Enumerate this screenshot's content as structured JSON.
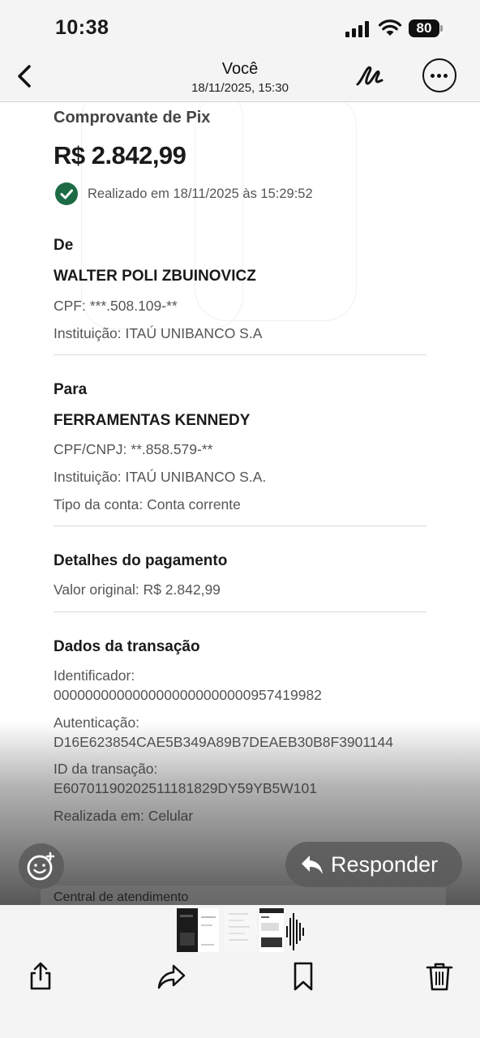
{
  "status": {
    "time": "10:38",
    "battery": "80"
  },
  "nav": {
    "title": "Você",
    "subtitle": "18/11/2025, 15:30"
  },
  "receipt": {
    "title": "Comprovante de Pix",
    "amount": "R$ 2.842,99",
    "completed": "Realizado em 18/11/2025 às 15:29:52",
    "from": {
      "label": "De",
      "name": "WALTER POLI ZBUINOVICZ",
      "doc": "CPF: ***.508.109-**",
      "institution": "Instituição: ITAÚ UNIBANCO S.A"
    },
    "to": {
      "label": "Para",
      "name": "FERRAMENTAS KENNEDY",
      "doc": "CPF/CNPJ: **.858.579-**",
      "institution": "Instituição: ITAÚ UNIBANCO S.A.",
      "account_type": "Tipo da conta: Conta corrente"
    },
    "payment": {
      "label": "Detalhes do pagamento",
      "original_value": "Valor original: R$ 2.842,99"
    },
    "transaction": {
      "label": "Dados da transação",
      "identifier_label": "Identificador:",
      "identifier_value": "0000000000000000000000000957419982",
      "auth_label": "Autenticação:",
      "auth_value": "D16E623854CAE5B349A89B7DEAEB30B8F3901144",
      "id_label": "ID da transação:",
      "id_value": "E60701190202511181829DY59YB5W101",
      "channel": "Realizada em: Celular"
    },
    "footer": "Central de atendimento"
  },
  "actions": {
    "reply_label": "Responder"
  },
  "icons": {
    "back": "chevron-left-icon",
    "markup": "markup-pen-icon",
    "more": "ellipsis-circle-icon",
    "emoji": "add-reaction-icon",
    "reply": "reply-arrow-icon",
    "share": "share-icon",
    "forward": "forward-icon",
    "bookmark": "bookmark-icon",
    "trash": "trash-icon"
  },
  "colors": {
    "success_green": "#1c6b45"
  }
}
